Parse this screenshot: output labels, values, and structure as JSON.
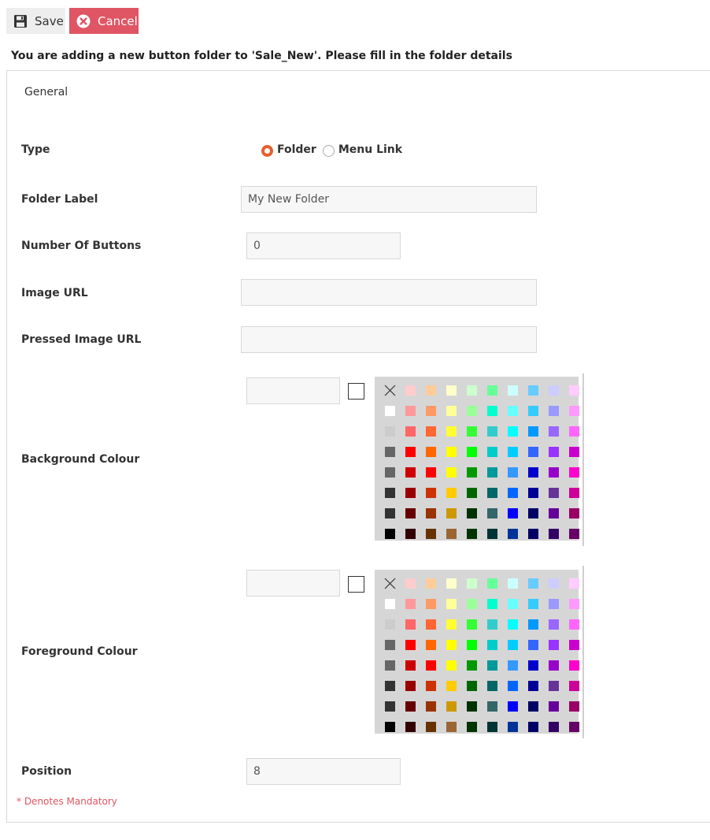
{
  "toolbar": {
    "save_label": "Save",
    "cancel_label": "Cancel",
    "save_icon": "floppy-disk-icon",
    "cancel_icon": "close-circle-icon"
  },
  "intro_text": "You are adding a new button folder to 'Sale_New'. Please fill in the folder details",
  "tab_general": "General",
  "fields": {
    "type_label": "Type",
    "type_options": [
      "Folder",
      "Menu Link"
    ],
    "type_selected": "Folder",
    "folder_label_label": "Folder Label",
    "folder_label_value": "My New Folder",
    "num_buttons_label": "Number Of Buttons",
    "num_buttons_value": "0",
    "image_url_label": "Image URL",
    "image_url_value": "",
    "pressed_image_url_label": "Pressed Image URL",
    "pressed_image_url_value": "",
    "bg_colour_label": "Background Colour",
    "bg_colour_value": "",
    "fg_colour_label": "Foreground Colour",
    "fg_colour_value": "",
    "position_label": "Position",
    "position_value": "8"
  },
  "mandatory_note": "* Denotes Mandatory",
  "palette_colors": [
    [
      "none",
      "#ffcccc",
      "#ffcc99",
      "#ffffcc",
      "#ccffcc",
      "#66ff99",
      "#ccffff",
      "#66ccff",
      "#ccccff",
      "#ffccff"
    ],
    [
      "#ffffff",
      "#ff9999",
      "#ff9966",
      "#ffff99",
      "#99ff99",
      "#00ffcc",
      "#66ffff",
      "#33ccff",
      "#9999ff",
      "#ff99ff"
    ],
    [
      "#cccccc",
      "#ff6666",
      "#ff6633",
      "#ffff33",
      "#33ff33",
      "#33cccc",
      "#00ffff",
      "#0099ff",
      "#9966ff",
      "#ff66ff"
    ],
    [
      "#666666",
      "#ff0000",
      "#ff6600",
      "#ffff00",
      "#00ff00",
      "#00cccc",
      "#00ccff",
      "#3366ff",
      "#9933ff",
      "#cc00cc"
    ],
    [
      "#666666",
      "#cc0000",
      "#ff0000",
      "#ffff00",
      "#009900",
      "#009999",
      "#3399ff",
      "#0000cc",
      "#9900cc",
      "#ff00cc"
    ],
    [
      "#333333",
      "#990000",
      "#cc3300",
      "#ffcc00",
      "#006600",
      "#006666",
      "#0066ff",
      "#000099",
      "#663399",
      "#cc0099"
    ],
    [
      "#333333",
      "#660000",
      "#993300",
      "#cc9900",
      "#003300",
      "#336666",
      "#0000ff",
      "#000066",
      "#660099",
      "#990066"
    ],
    [
      "#000000",
      "#330000",
      "#663300",
      "#996633",
      "#003300",
      "#003333",
      "#003399",
      "#000066",
      "#330066",
      "#660066"
    ]
  ],
  "colors": {
    "accent": "#e4602e",
    "cancel": "#e05564",
    "mandatory": "#e05564"
  }
}
